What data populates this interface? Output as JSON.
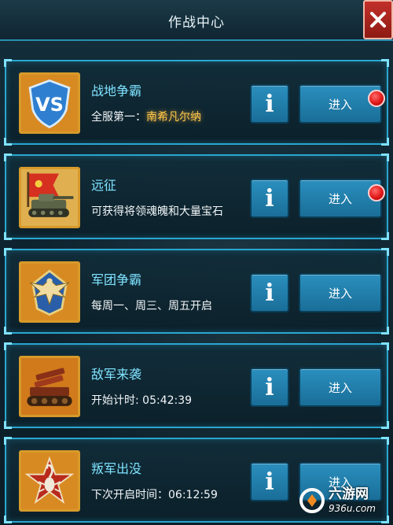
{
  "header": {
    "title": "作战中心"
  },
  "missions": [
    {
      "title": "战地争霸",
      "desc_prefix": "全服第一：",
      "desc_highlight": "南希凡尔纳",
      "info_label": "i",
      "enter_label": "进入",
      "has_notification": true,
      "icon": "vs-shield-icon"
    },
    {
      "title": "远征",
      "desc_prefix": "可获得将领魂魄和大量宝石",
      "desc_highlight": "",
      "info_label": "i",
      "enter_label": "进入",
      "has_notification": true,
      "icon": "tank-flag-icon"
    },
    {
      "title": "军团争霸",
      "desc_prefix": "每周一、周三、周五开启",
      "desc_highlight": "",
      "info_label": "i",
      "enter_label": "进入",
      "has_notification": false,
      "icon": "eagle-emblem-icon"
    },
    {
      "title": "敌军来袭",
      "desc_prefix": "开始计时: 05:42:39",
      "desc_highlight": "",
      "info_label": "i",
      "enter_label": "进入",
      "has_notification": false,
      "icon": "rocket-vehicle-icon"
    },
    {
      "title": "叛军出没",
      "desc_prefix": "下次开启时间：06:12:59",
      "desc_highlight": "",
      "info_label": "i",
      "enter_label": "进入",
      "has_notification": false,
      "icon": "scorpion-star-icon"
    }
  ],
  "watermark": {
    "main": "六游网",
    "sub": "936u.com"
  },
  "colors": {
    "accent_border": "#2aa6d0",
    "title_text": "#7fe3ff",
    "highlight_text": "#ffc84a",
    "button_blue": "#2b8fbe",
    "notification_red": "#e01818",
    "close_red": "#c2302a"
  }
}
